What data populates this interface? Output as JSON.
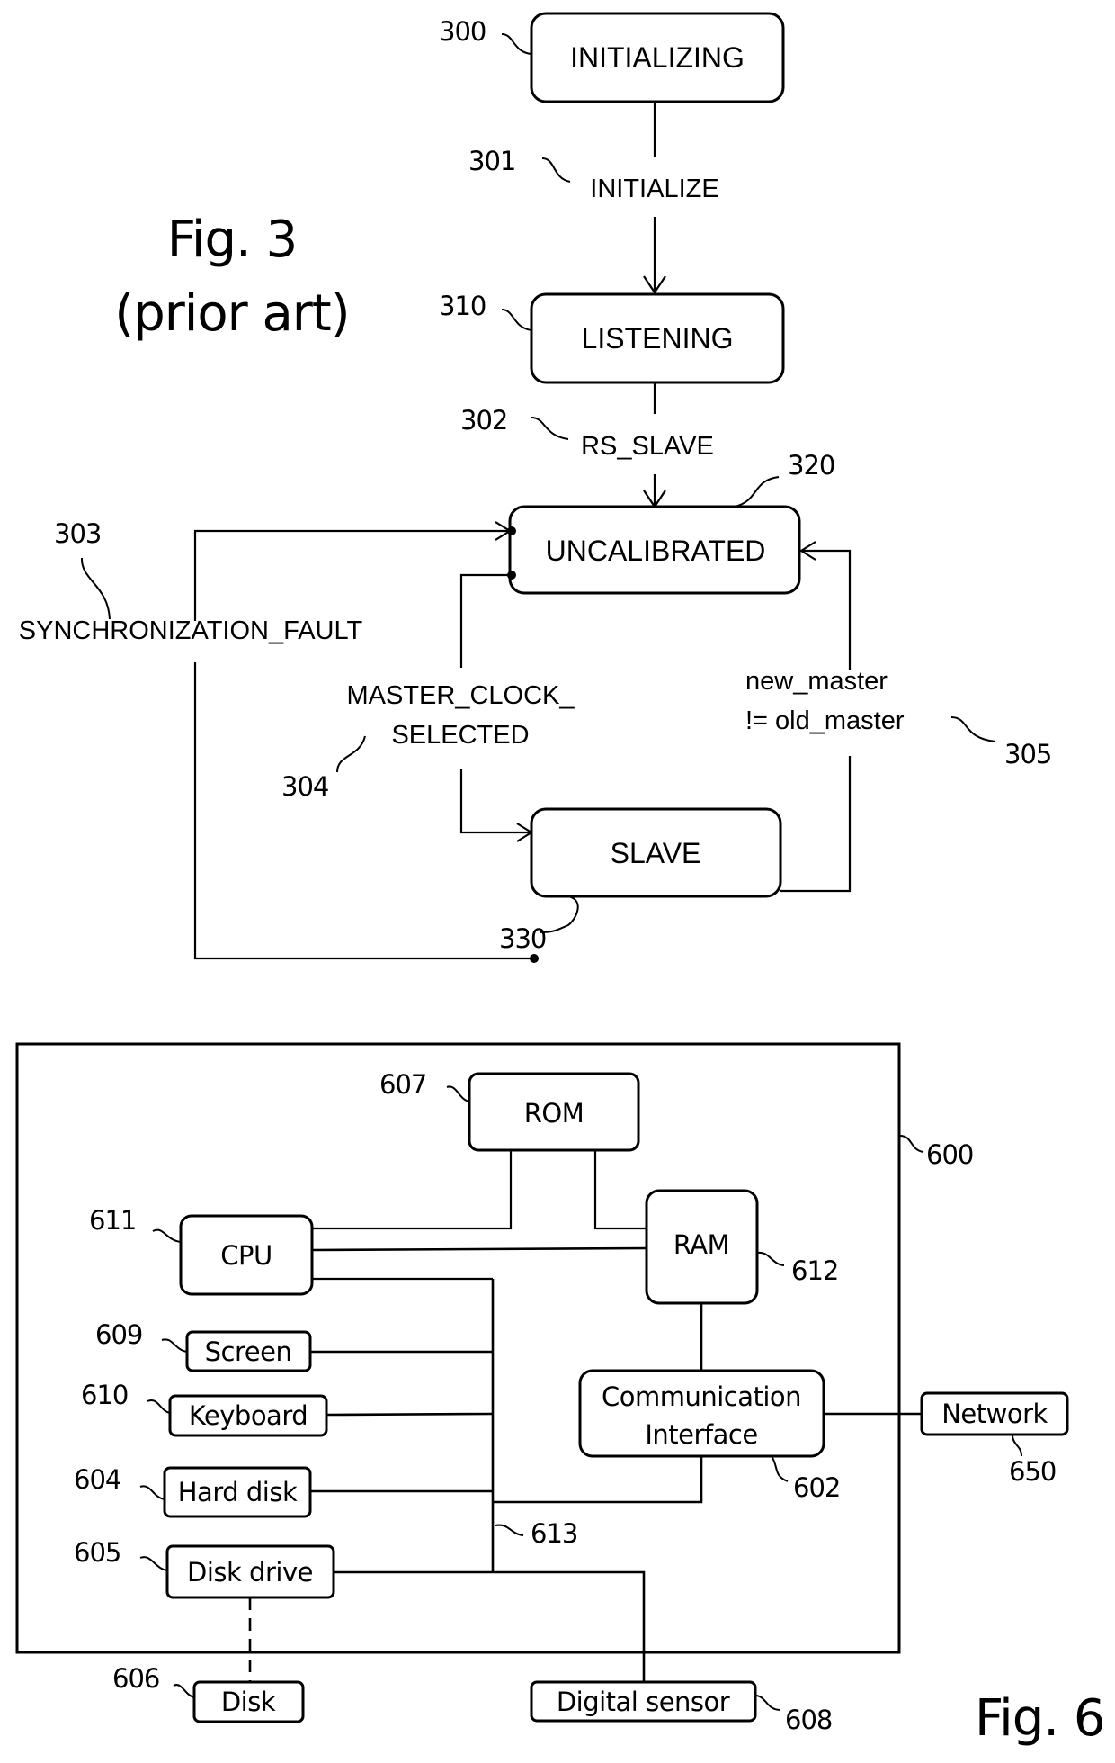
{
  "fig3": {
    "title": "Fig. 3",
    "subtitle": "(prior art)",
    "states": {
      "initializing": {
        "label": "INITIALIZING",
        "ref": "300"
      },
      "listening": {
        "label": "LISTENING",
        "ref": "310"
      },
      "uncalibrated": {
        "label": "UNCALIBRATED",
        "ref": "320"
      },
      "slave": {
        "label": "SLAVE",
        "ref": "330"
      }
    },
    "transitions": {
      "initialize": {
        "label": "INITIALIZE",
        "ref": "301"
      },
      "rs_slave": {
        "label": "RS_SLAVE",
        "ref": "302"
      },
      "sync_fault": {
        "label": "SYNCHRONIZATION_FAULT",
        "ref": "303"
      },
      "master_clock_selected": {
        "line1": "MASTER_CLOCK_",
        "line2": "SELECTED",
        "ref": "304"
      },
      "new_master": {
        "line1": "new_master",
        "line2": "!= old_master",
        "ref": "305"
      }
    }
  },
  "fig6": {
    "title": "Fig. 6",
    "device_ref": "600",
    "blocks": {
      "rom": {
        "label": "ROM",
        "ref": "607"
      },
      "cpu": {
        "label": "CPU",
        "ref": "611"
      },
      "ram": {
        "label": "RAM",
        "ref": "612"
      },
      "screen": {
        "label": "Screen",
        "ref": "609"
      },
      "keyboard": {
        "label": "Keyboard",
        "ref": "610"
      },
      "hard_disk": {
        "label": "Hard disk",
        "ref": "604"
      },
      "disk_drive": {
        "label": "Disk drive",
        "ref": "605"
      },
      "comm": {
        "line1": "Communication",
        "line2": "Interface",
        "ref": "602"
      },
      "network": {
        "label": "Network",
        "ref": "650"
      },
      "disk": {
        "label": "Disk",
        "ref": "606"
      },
      "sensor": {
        "label": "Digital sensor",
        "ref": "608"
      }
    },
    "bus_ref": "613"
  }
}
